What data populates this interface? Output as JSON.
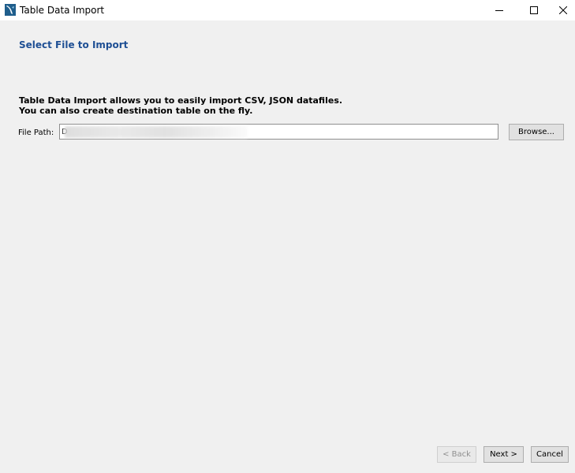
{
  "window": {
    "title": "Table Data Import",
    "icon": "mysql-workbench-icon",
    "controls": {
      "minimize": "minimize-icon",
      "maximize": "maximize-icon",
      "close": "close-icon"
    }
  },
  "header": {
    "title": "Select File to Import"
  },
  "description": {
    "line1": "Table Data Import allows you to easily import CSV, JSON datafiles.",
    "line2": "You can also create destination table on the fly."
  },
  "file_path": {
    "label": "File Path:",
    "value": "D"
  },
  "buttons": {
    "browse": "Browse...",
    "back": "< Back",
    "next": "Next >",
    "cancel": "Cancel"
  },
  "colors": {
    "header_title": "#1e4f94",
    "background": "#f0f0f0"
  }
}
